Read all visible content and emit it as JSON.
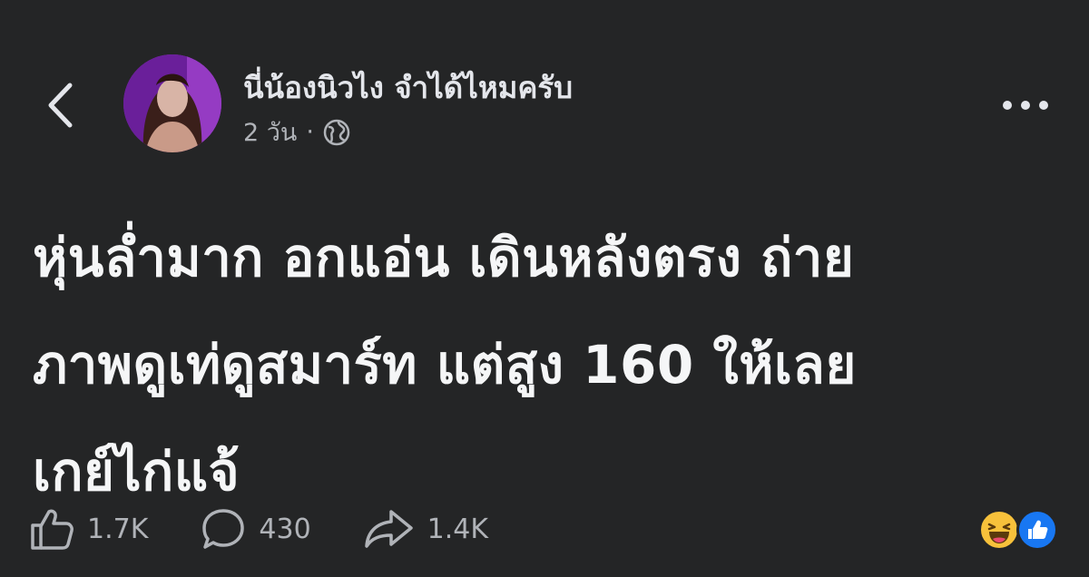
{
  "header": {
    "back_icon": "chevron-left-icon",
    "author_name": "นี่น้องนิวไง จำได้ไหมครับ",
    "timestamp": "2 วัน",
    "separator": "·",
    "audience_icon": "globe-icon",
    "more_icon": "ellipsis-icon"
  },
  "post": {
    "lines": [
      "หุ่นล่ำมาก อกแอ่น เดินหลังตรง ถ่าย",
      "ภาพดูเท่ดูสมาร์ท แต่สูง 160 ให้เลย",
      "เกย์ไก่แจ้"
    ]
  },
  "actions": {
    "like": {
      "icon": "like-icon",
      "count": "1.7K"
    },
    "comment": {
      "icon": "comment-icon",
      "count": "430"
    },
    "share": {
      "icon": "share-icon",
      "count": "1.4K"
    }
  },
  "reactions": [
    "haha-icon",
    "like-reaction-icon"
  ],
  "colors": {
    "background": "#242526",
    "text": "#e4e6eb",
    "secondary": "#b0b3b8",
    "like_blue": "#1877f2",
    "haha_yellow": "#f7c13b"
  }
}
